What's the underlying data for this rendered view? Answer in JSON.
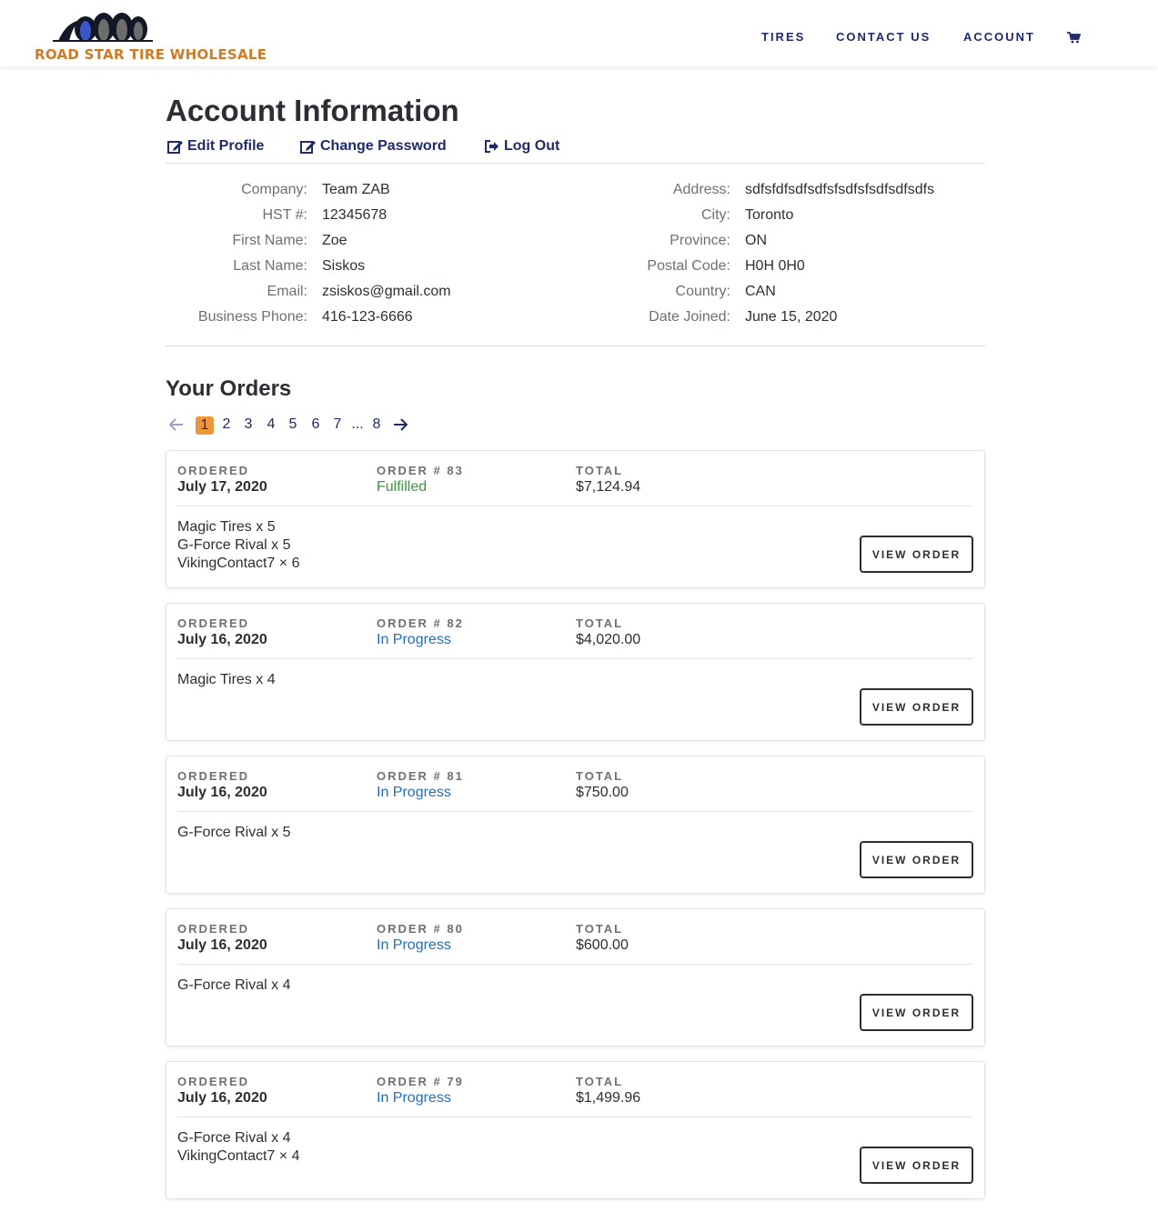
{
  "brand": {
    "name": "ROAD STAR TIRE WHOLESALE"
  },
  "nav": {
    "tires": "TIRES",
    "contact": "CONTACT US",
    "account": "ACCOUNT"
  },
  "page": {
    "title": "Account Information",
    "actions": {
      "edit_profile": "Edit Profile",
      "change_password": "Change Password",
      "log_out": "Log Out"
    }
  },
  "account": {
    "left": [
      {
        "label": "Company:",
        "value": "Team ZAB"
      },
      {
        "label": "HST #:",
        "value": "12345678"
      },
      {
        "label": "First Name:",
        "value": "Zoe"
      },
      {
        "label": "Last Name:",
        "value": "Siskos"
      },
      {
        "label": "Email:",
        "value": "zsiskos@gmail.com"
      },
      {
        "label": "Business Phone:",
        "value": "416-123-6666"
      }
    ],
    "right": [
      {
        "label": "Address:",
        "value": "sdfsfdfsdfsdfsfsdfsfsdfsdfsdfs"
      },
      {
        "label": "City:",
        "value": "Toronto"
      },
      {
        "label": "Province:",
        "value": "ON"
      },
      {
        "label": "Postal Code:",
        "value": "H0H 0H0"
      },
      {
        "label": "Country:",
        "value": "CAN"
      },
      {
        "label": "Date Joined:",
        "value": "June 15, 2020"
      }
    ]
  },
  "orders": {
    "title": "Your Orders",
    "pagination": {
      "pages": [
        "1",
        "2",
        "3",
        "4",
        "5",
        "6",
        "7"
      ],
      "ellipsis": "...",
      "last": "8",
      "current": "1"
    },
    "labels": {
      "ordered": "ORDERED",
      "total": "TOTAL",
      "view": "VIEW ORDER"
    },
    "list": [
      {
        "number": "ORDER # 83",
        "date": "July 17, 2020",
        "status": "Fulfilled",
        "total": "$7,124.94",
        "items": [
          "Magic Tires x 5",
          "G-Force Rival x 5",
          "VikingContact7 × 6"
        ]
      },
      {
        "number": "ORDER # 82",
        "date": "July 16, 2020",
        "status": "In Progress",
        "total": "$4,020.00",
        "items": [
          "Magic Tires x 4"
        ]
      },
      {
        "number": "ORDER # 81",
        "date": "July 16, 2020",
        "status": "In Progress",
        "total": "$750.00",
        "items": [
          "G-Force Rival x 5"
        ]
      },
      {
        "number": "ORDER # 80",
        "date": "July 16, 2020",
        "status": "In Progress",
        "total": "$600.00",
        "items": [
          "G-Force Rival x 4"
        ]
      },
      {
        "number": "ORDER # 79",
        "date": "July 16, 2020",
        "status": "In Progress",
        "total": "$1,499.96",
        "items": [
          "G-Force Rival x 4",
          "VikingContact7 × 4"
        ]
      }
    ]
  },
  "colors": {
    "navy": "#1f2a6b",
    "brand_orange": "#d17a25",
    "page_active": "#f0963a",
    "fulfilled": "#3c963c",
    "in_progress": "#1f6ec2"
  },
  "icons": {
    "cart": "cart-icon",
    "edit": "edit-icon",
    "logout": "logout-icon",
    "prev": "arrow-left-icon",
    "next": "arrow-right-icon"
  }
}
